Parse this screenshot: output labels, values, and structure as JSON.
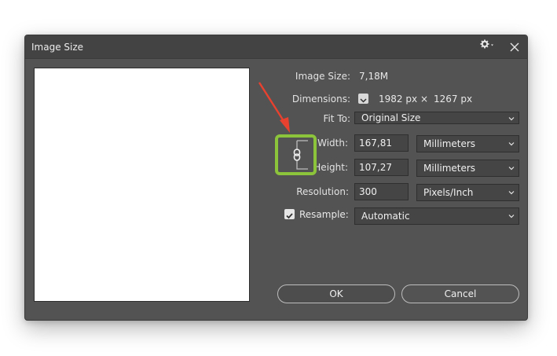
{
  "dialog": {
    "title": "Image Size"
  },
  "info": {
    "image_size_label": "Image Size:",
    "image_size_value": "7,18M",
    "dimensions_label": "Dimensions:",
    "dimensions_width": "1982 px",
    "dimensions_x": "×",
    "dimensions_height": "1267 px"
  },
  "fit_to": {
    "label": "Fit To:",
    "value": "Original Size"
  },
  "width": {
    "label": "Width:",
    "value": "167,81",
    "unit": "Millimeters"
  },
  "height": {
    "label": "Height:",
    "value": "107,27",
    "unit": "Millimeters"
  },
  "resolution": {
    "label": "Resolution:",
    "value": "300",
    "unit": "Pixels/Inch"
  },
  "resample": {
    "label": "Resample:",
    "checked": true,
    "value": "Automatic"
  },
  "buttons": {
    "ok": "OK",
    "cancel": "Cancel"
  },
  "icons": {
    "close": "close-icon",
    "gear": "gear-icon",
    "link": "chain-link-icon",
    "chevron": "chevron-down-icon",
    "check": "check-icon"
  },
  "colors": {
    "dialog_bg": "#535353",
    "titlebar_bg": "#434343",
    "highlight": "#8cc43c",
    "arrow": "#e8412f"
  }
}
